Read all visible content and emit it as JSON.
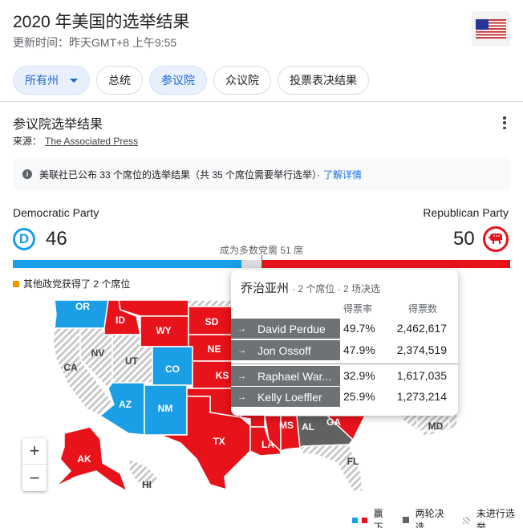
{
  "header": {
    "title": "2020 年美国的选举结果",
    "updated": "更新时间：昨天GMT+8 上午9:55"
  },
  "chips": {
    "all_states": "所有州",
    "president": "总统",
    "senate": "参议院",
    "house": "众议院",
    "ballot": "投票表决结果"
  },
  "section": {
    "title": "参议院选举结果",
    "source_label": "来源：",
    "source_link": "The Associated Press"
  },
  "info": {
    "text": "美联社已公布 33 个席位的选举结果（共 35 个席位需要举行选举）·",
    "link": "了解详情"
  },
  "tally": {
    "dem_label": "Democratic Party",
    "rep_label": "Republican Party",
    "dem_badge": "D",
    "dem_seats": "46",
    "rep_seats": "50",
    "majority": "成为多数党需 51 席",
    "others": "其他政党获得了 2 个席位",
    "dem_fraction": 0.46,
    "rep_fraction": 0.5
  },
  "map": {
    "labels": {
      "or": "OR",
      "ca": "CA",
      "nv": "NV",
      "id": "ID",
      "ut": "UT",
      "az": "AZ",
      "wy": "WY",
      "co": "CO",
      "nm": "NM",
      "sd": "SD",
      "ne": "NE",
      "ks": "KS",
      "tx": "TX",
      "la": "LA",
      "ms": "MS",
      "al": "AL",
      "ga": "GA",
      "fl": "FL",
      "md": "MD",
      "ak": "AK",
      "hi": "HI"
    },
    "zoom_in": "+",
    "zoom_out": "−"
  },
  "legend": {
    "won": "赢下",
    "runoff": "两轮决选",
    "no_election": "未进行选举"
  },
  "popup": {
    "state": "乔治亚州",
    "subtitle": "· 2 个席位 · 2 场决选",
    "col_pct": "得票率",
    "col_votes": "得票数",
    "race1": [
      {
        "name": "David Perdue",
        "pct": "49.7%",
        "votes": "2,462,617"
      },
      {
        "name": "Jon Ossoff",
        "pct": "47.9%",
        "votes": "2,374,519"
      }
    ],
    "race2": [
      {
        "name": "Raphael War...",
        "pct": "32.9%",
        "votes": "1,617,035"
      },
      {
        "name": "Kelly Loeffler",
        "pct": "25.9%",
        "votes": "1,273,214"
      }
    ],
    "arrow": "→"
  },
  "colors": {
    "dem": "#1a9ee5",
    "rep": "#e8121a",
    "runoff": "#616161"
  }
}
